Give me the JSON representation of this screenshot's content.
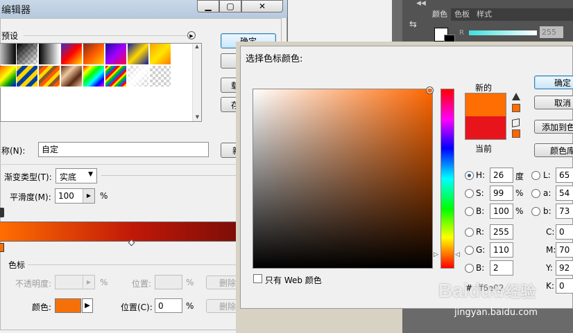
{
  "gradient_editor": {
    "title": "编辑器",
    "presets_label": "预设",
    "ok_label": "确定",
    "load_label": "载",
    "save_label": "存",
    "new_label": "新",
    "name_label": "称(N):",
    "name_value": "自定",
    "gradient_type_label": "渐变类型(T):",
    "gradient_type_value": "实底",
    "smoothness_label": "平滑度(M):",
    "smoothness_value": "100",
    "smoothness_unit": "%",
    "color_stops_label": "色标",
    "opacity_label": "不透明度:",
    "opacity_unit": "%",
    "opacity_location_label": "位置:",
    "opacity_location_unit": "%",
    "delete_label": "删除",
    "color_label": "颜色:",
    "color_location_label": "位置(C):",
    "color_location_value": "0",
    "color_location_unit": "%",
    "stop_color": "#f6700a"
  },
  "color_picker": {
    "title": "选择色标颜色:",
    "new_label": "新的",
    "current_label": "当前",
    "new_color": "#ff6e02",
    "current_color": "#e8141c",
    "ok_label": "确定",
    "cancel_label": "取消",
    "add_to_swatches_label": "添加到色",
    "color_libraries_label": "颜色库",
    "web_only_label": "只有 Web 颜色",
    "hex_prefix": "#",
    "hex_value": "ff6e02",
    "hue_color": "#ff6600",
    "hsb": [
      {
        "key": "H:",
        "value": "26",
        "unit": "度"
      },
      {
        "key": "S:",
        "value": "99",
        "unit": "%"
      },
      {
        "key": "B:",
        "value": "100",
        "unit": "%"
      }
    ],
    "rgb": [
      {
        "key": "R:",
        "value": "255"
      },
      {
        "key": "G:",
        "value": "110"
      },
      {
        "key": "B:",
        "value": "2"
      }
    ],
    "lab": [
      {
        "key": "L:",
        "value": "65"
      },
      {
        "key": "a:",
        "value": "54"
      },
      {
        "key": "b:",
        "value": "73"
      }
    ],
    "cmyk": [
      {
        "key": "C:",
        "value": "0"
      },
      {
        "key": "M:",
        "value": "70"
      },
      {
        "key": "Y:",
        "value": "92"
      },
      {
        "key": "K:",
        "value": "0"
      }
    ]
  },
  "color_panel": {
    "tabs": [
      "颜色",
      "色板",
      "样式"
    ],
    "slider_label": "R",
    "slider_value": "255"
  },
  "watermark": {
    "brand": "Baidu",
    "brand_cn": "经验",
    "url": "jingyan.baidu.com"
  }
}
